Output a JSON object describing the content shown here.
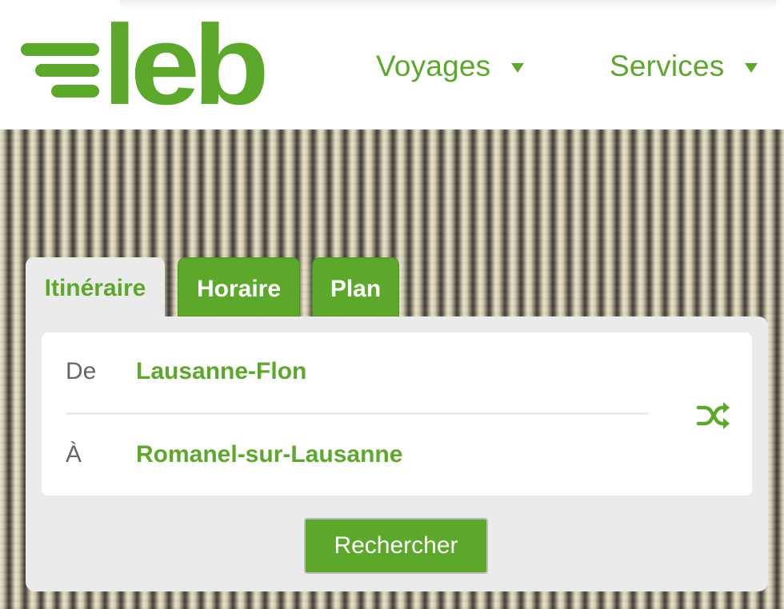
{
  "header": {
    "logo_text": "leb",
    "nav": [
      {
        "label": "Voyages"
      },
      {
        "label": "Services"
      }
    ]
  },
  "widget": {
    "tabs": [
      {
        "label": "Itinéraire",
        "active": true
      },
      {
        "label": "Horaire",
        "active": false
      },
      {
        "label": "Plan",
        "active": false
      }
    ],
    "from": {
      "label": "De",
      "value": "Lausanne-Flon"
    },
    "to": {
      "label": "À",
      "value": "Romanel-sur-Lausanne"
    },
    "swap_icon": "shuffle-icon",
    "search_label": "Rechercher"
  },
  "colors": {
    "brand_green": "#5ba82a",
    "panel_gray": "#ebebeb"
  }
}
